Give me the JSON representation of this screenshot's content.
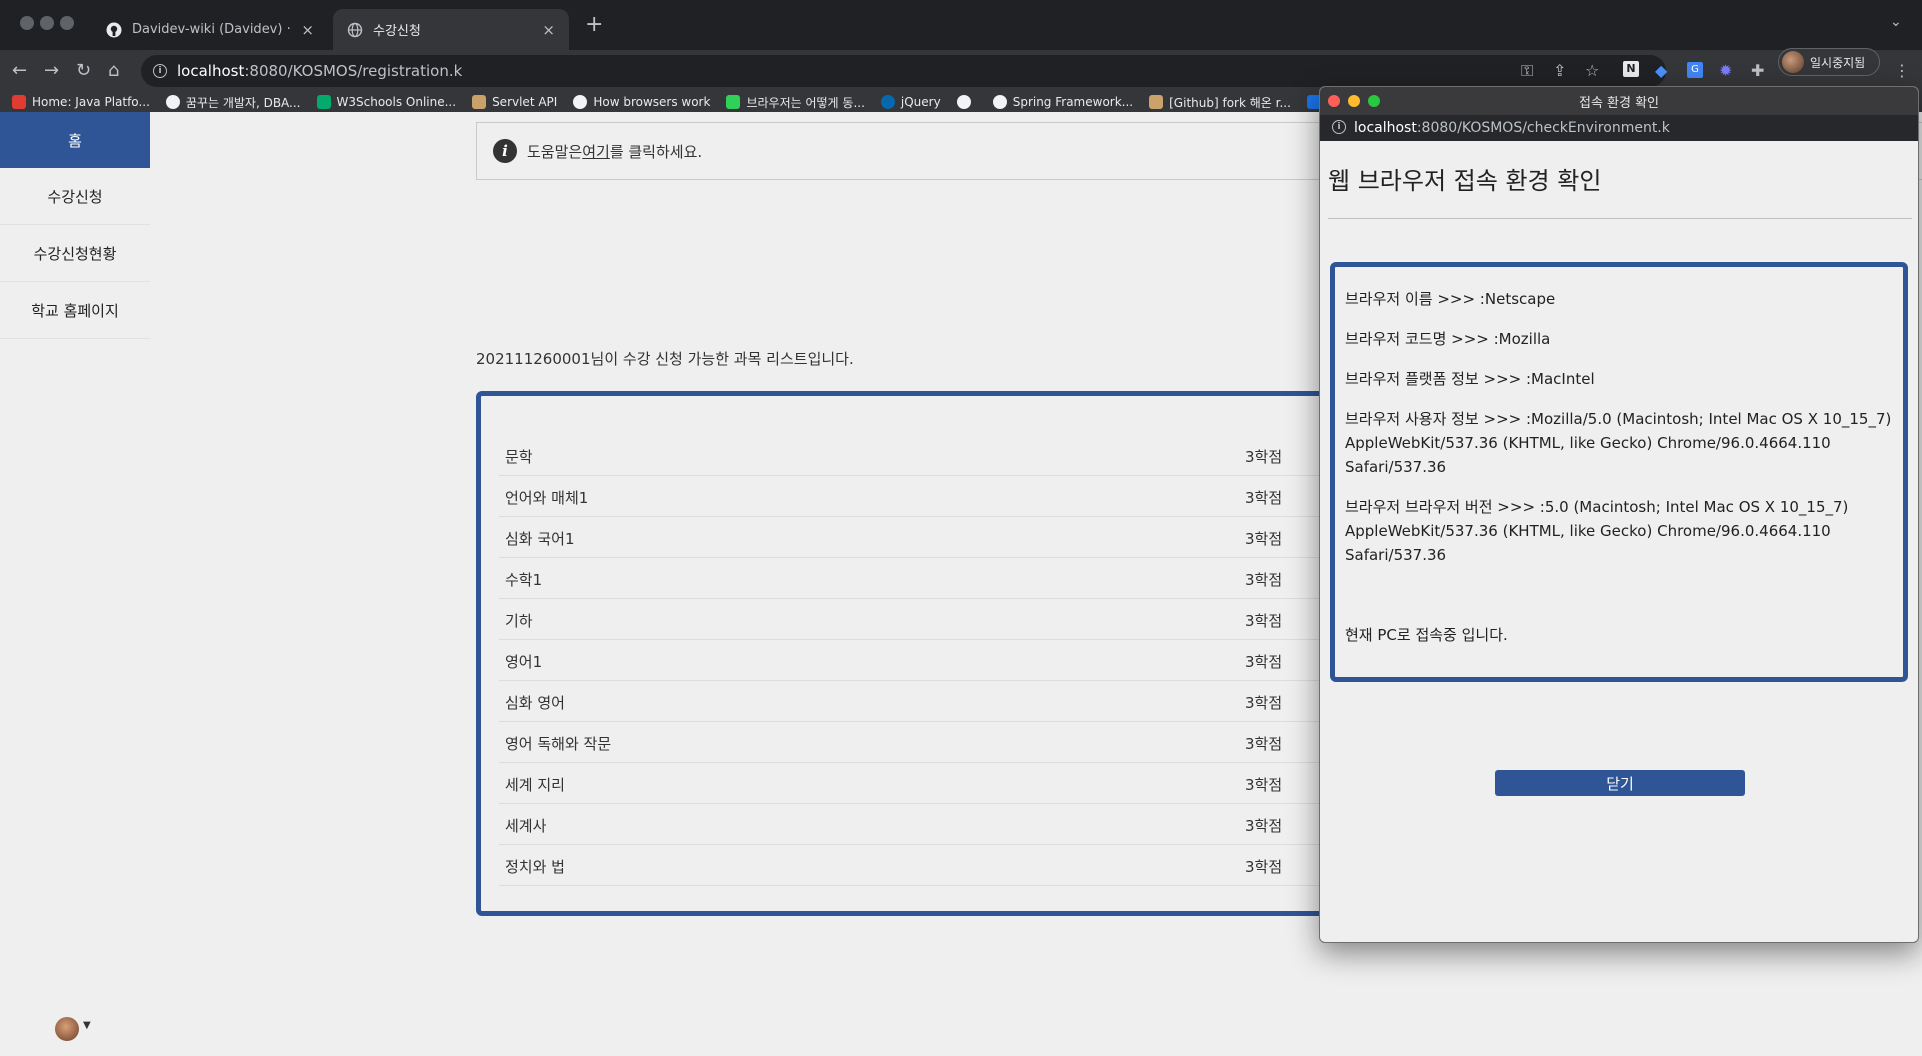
{
  "browser": {
    "tabs": [
      {
        "label": "Davidev-wiki (Davidev) · GitHub",
        "icon": "github-icon",
        "active": false
      },
      {
        "label": "수강신청",
        "icon": "globe-icon",
        "active": true
      }
    ],
    "new_tab_label": "+",
    "tab_close": "×",
    "url": {
      "host": "localhost",
      "path": ":8080/KOSMOS/registration.k"
    },
    "profile_label": "일시중지됨",
    "bookmarks": [
      {
        "label": "Home: Java Platfo...",
        "color": "#e03c31"
      },
      {
        "label": "꿈꾸는 개발자, DBA...",
        "color": "#f1f3f4"
      },
      {
        "label": "W3Schools Online...",
        "color": "#04aa6d"
      },
      {
        "label": "Servlet API",
        "color": "#c8a26a"
      },
      {
        "label": "How browsers work",
        "color": "#f1f3f4"
      },
      {
        "label": "브라우저는 어떻게 동...",
        "color": "#30d158"
      },
      {
        "label": "jQuery",
        "color": "#0769ad"
      },
      {
        "label": "",
        "color": "#f1f3f4"
      },
      {
        "label": "Spring Framework...",
        "color": "#f1f3f4"
      },
      {
        "label": "[Github] fork 해온 r...",
        "color": "#c9a36b"
      },
      {
        "label": "",
        "color": "#1a73e8"
      }
    ]
  },
  "sidebar": {
    "items": [
      {
        "label": "홈",
        "active": true
      },
      {
        "label": "수강신청",
        "active": false
      },
      {
        "label": "수강신청현황",
        "active": false
      },
      {
        "label": "학교 홈페이지",
        "active": false
      }
    ]
  },
  "main": {
    "help_prefix": "도움말은 ",
    "help_link": "여기",
    "help_suffix": "를 클릭하세요.",
    "list_caption": "202111260001님이 수강 신청 가능한 과목 리스트입니다.",
    "courses": [
      {
        "name": "문학",
        "credit": "3학점"
      },
      {
        "name": "언어와 매체1",
        "credit": "3학점"
      },
      {
        "name": "심화 국어1",
        "credit": "3학점"
      },
      {
        "name": "수학1",
        "credit": "3학점"
      },
      {
        "name": "기하",
        "credit": "3학점"
      },
      {
        "name": "영어1",
        "credit": "3학점"
      },
      {
        "name": "심화 영어",
        "credit": "3학점"
      },
      {
        "name": "영어 독해와 작문",
        "credit": "3학점"
      },
      {
        "name": "세계 지리",
        "credit": "3학점"
      },
      {
        "name": "세계사",
        "credit": "3학점"
      },
      {
        "name": "정치와 법",
        "credit": "3학점"
      }
    ]
  },
  "popup": {
    "window_title": "접속 환경 확인",
    "url": {
      "host": "localhost",
      "path": ":8080/KOSMOS/checkEnvironment.k"
    },
    "heading": "웹 브라우저 접속 환경 확인",
    "lines": [
      "브라우저 이름 >>> :Netscape",
      "브라우저 코드명 >>> :Mozilla",
      "브라우저 플랫폼 정보 >>> :MacIntel",
      "브라우저 사용자 정보 >>> :Mozilla/5.0 (Macintosh; Intel Mac OS X 10_15_7) AppleWebKit/537.36 (KHTML, like Gecko) Chrome/96.0.4664.110 Safari/537.36",
      "브라우저 브라우저 버전 >>> :5.0 (Macintosh; Intel Mac OS X 10_15_7) AppleWebKit/537.36 (KHTML, like Gecko) Chrome/96.0.4664.110 Safari/537.36",
      "현재 PC로 접속중 입니다."
    ],
    "close_label": "닫기"
  },
  "colors": {
    "accent": "#2f5597",
    "page_bg": "#efefef",
    "chrome_dark": "#202124"
  }
}
